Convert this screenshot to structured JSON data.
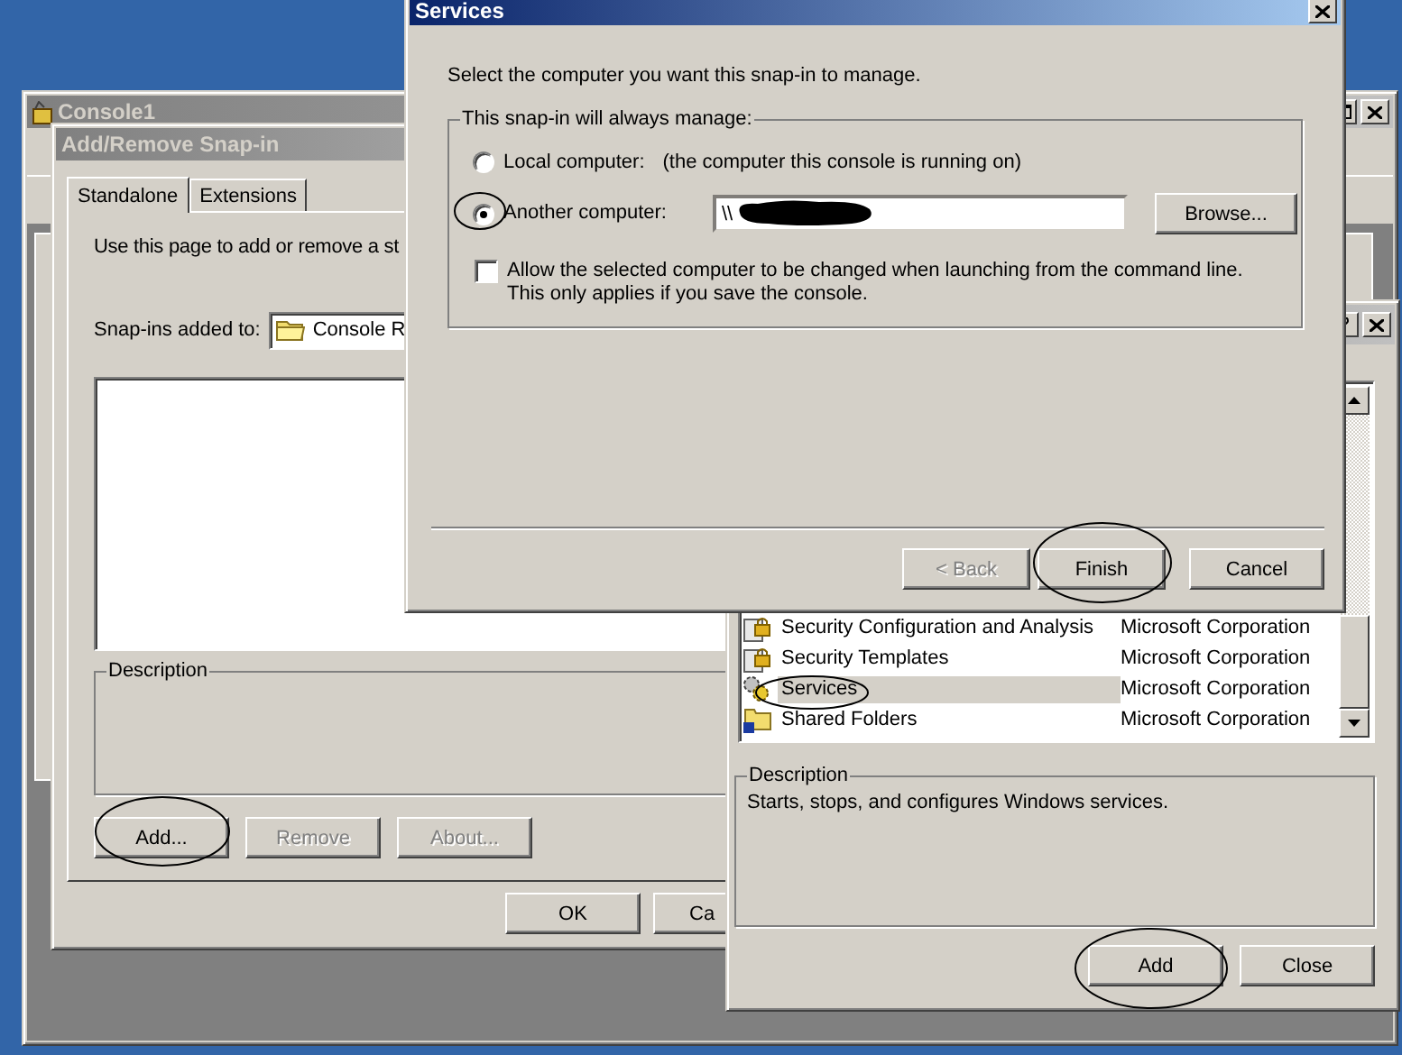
{
  "console_window": {
    "title": "Console1"
  },
  "snapin_dialog": {
    "title": "Add/Remove Snap-in",
    "tabs": [
      {
        "label": "Standalone",
        "selected": true
      },
      {
        "label": "Extensions",
        "selected": false
      }
    ],
    "intro": "Use this page to add or remove a st",
    "added_to_label": "Snap-ins added to:",
    "added_to_value": "Console R",
    "description_label": "Description",
    "buttons": [
      {
        "label": "Add...",
        "disabled": false
      },
      {
        "label": "Remove",
        "disabled": true
      },
      {
        "label": "About...",
        "disabled": true
      }
    ],
    "footer_buttons": [
      "OK",
      "Ca"
    ]
  },
  "standalone_dialog": {
    "rows": [
      {
        "name": "Security Configuration and Analysis",
        "vendor": "Microsoft Corporation",
        "kind": "lock",
        "selected": false
      },
      {
        "name": "Security Templates",
        "vendor": "Microsoft Corporation",
        "kind": "lock",
        "selected": false
      },
      {
        "name": "Services",
        "vendor": "Microsoft Corporation",
        "kind": "gear",
        "selected": true
      },
      {
        "name": "Shared Folders",
        "vendor": "Microsoft Corporation",
        "kind": "folder",
        "selected": false
      }
    ],
    "description_label": "Description",
    "description": "Starts, stops, and configures Windows services.",
    "buttons": [
      "Add",
      "Close"
    ]
  },
  "services_dialog": {
    "title": "Services",
    "prompt": "Select the computer you want this snap-in to manage.",
    "group_label": "This snap-in will always manage:",
    "options": [
      {
        "label": "Local computer:",
        "note": "(the computer this console is running on)",
        "selected": false
      },
      {
        "label": "Another computer:",
        "selected": true
      }
    ],
    "computer_value": "\\\\",
    "browse": "Browse...",
    "allow_change": {
      "label": "Allow the selected computer to be changed when launching from the command line.  This only applies if you save the console.",
      "checked": false
    },
    "buttons": [
      {
        "label": "< Back",
        "disabled": true
      },
      {
        "label": "Finish",
        "disabled": false
      },
      {
        "label": "Cancel",
        "disabled": false
      }
    ]
  }
}
